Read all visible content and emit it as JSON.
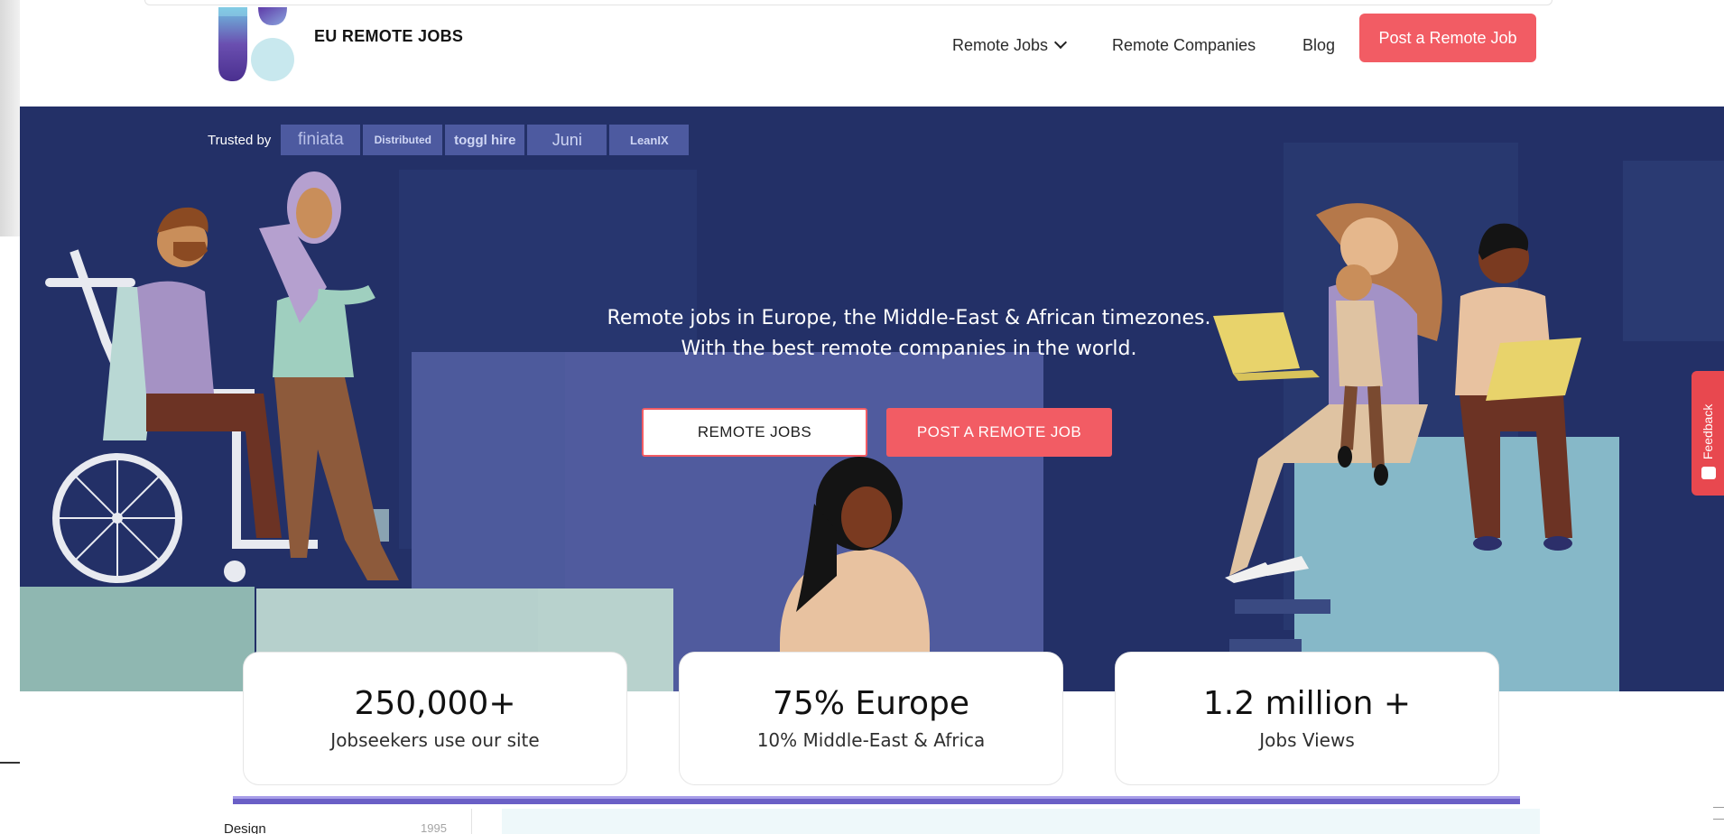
{
  "site": {
    "logo_text": "EU REMOTE JOBS"
  },
  "nav": {
    "remote_jobs": "Remote Jobs",
    "remote_companies": "Remote Companies",
    "blog": "Blog",
    "post_job": "Post a Remote Job"
  },
  "hero": {
    "trusted_label": "Trusted by",
    "trusted_brands": [
      "finiata",
      "Distributed",
      "toggl hire",
      "Juni",
      "LeanIX"
    ],
    "line1": "Remote jobs in Europe, the Middle-East & African timezones.",
    "line2": "With the best remote companies in the world.",
    "btn_remote_jobs": "REMOTE JOBS",
    "btn_post_job": "POST A REMOTE JOB"
  },
  "feedback": {
    "label": "Feedback"
  },
  "stats": [
    {
      "value": "250,000+",
      "label": "Jobseekers use our site"
    },
    {
      "value": "75% Europe",
      "label": "10% Middle-East & Africa"
    },
    {
      "value": "1.2 million +",
      "label": "Jobs Views"
    }
  ],
  "sidebar": {
    "category": "Design",
    "count": "1995"
  },
  "colors": {
    "accent": "#f25c64",
    "hero_bg": "#233067",
    "stripe": "#6a5fc6"
  }
}
